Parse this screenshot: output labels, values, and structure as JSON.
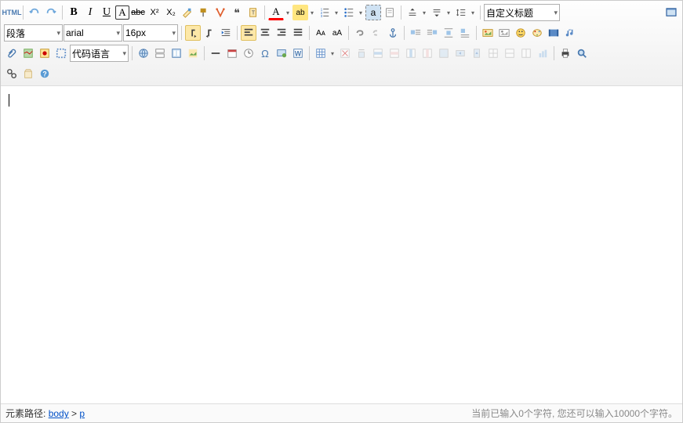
{
  "row1": {
    "html_label": "HTML"
  },
  "selects": {
    "paragraph": "段落",
    "font": "arial",
    "size": "16px",
    "codelang": "代码语言",
    "custom_title": "自定义标题"
  },
  "format": {
    "bold": "B",
    "italic": "I",
    "underline": "U",
    "fontborder": "A",
    "strike": "abc",
    "sup": "X²",
    "sub": "X₂",
    "quote": "❝",
    "fontA": "A",
    "highlight": "ab"
  },
  "status": {
    "path_label": "元素路径:",
    "path_body": "body",
    "path_sep": " > ",
    "path_p": "p",
    "count_text": "当前已输入0个字符, 您还可以输入10000个字符。"
  },
  "content": ""
}
